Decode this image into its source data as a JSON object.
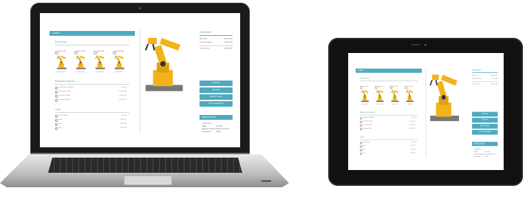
{
  "app": {
    "header_title": "LOREM",
    "section_robot_type": "Robot type",
    "section_payload": "Maximum payload",
    "section_color": "Color",
    "robots": [
      {
        "label": "Type 100",
        "price": "40,000 USD"
      },
      {
        "label": "Type 200",
        "price": "45,000 USD"
      },
      {
        "label": "Type 300",
        "price": "50,000 USD"
      },
      {
        "label": "Type 400",
        "price": "55,000 USD"
      }
    ],
    "payload_options": [
      {
        "label": "Double Arm (5kg Base)",
        "price": "included"
      },
      {
        "label": "Double Arm (10kg)",
        "price": "+ 2,000 USD"
      },
      {
        "label": "Telescopic (15kg)",
        "price": "+ 4,000 USD"
      },
      {
        "label": "Telescopic (20kg)",
        "price": "+ 6,000 USD"
      }
    ],
    "color_options": [
      {
        "label": "Sunset Yellow",
        "price": "included"
      },
      {
        "label": "White",
        "price": "+ 500 USD"
      },
      {
        "label": "Blue",
        "price": "+ 500 USD"
      },
      {
        "label": "Grey",
        "price": "+ 500 USD"
      }
    ],
    "summary": {
      "title": "SUMMARY",
      "rows": [
        {
          "label": "Base Price",
          "value": "40,000 USD"
        },
        {
          "label": "Selected Options",
          "value": "2,500 USD"
        },
        {
          "label": "Current Total",
          "value": "42,500 USD"
        }
      ]
    },
    "buttons": {
      "download": "Download",
      "view_3d": "3D Model",
      "add_to_cart": "ADD TO CART",
      "print": "Print Configuration"
    },
    "specs": {
      "title": "SPECIFICATIONS",
      "subtitle": "GENERAL",
      "rows": [
        {
          "label": "Model",
          "value": "Lord 180"
        },
        {
          "label": "Maximum Payload",
          "value": "Double Arm (10 K)"
        },
        {
          "label": "Accessories",
          "value": "Yellow"
        }
      ]
    }
  },
  "colors": {
    "accent": "#4eaabf",
    "robot_yellow": "#f2b21b",
    "device_bezel": "#1a1a1a"
  }
}
